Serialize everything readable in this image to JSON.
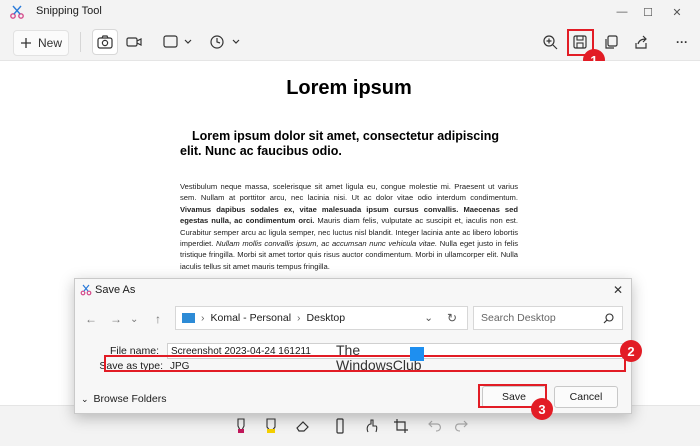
{
  "window": {
    "title": "Snipping Tool",
    "minimize": "—",
    "maximize": "☐",
    "close": "✕"
  },
  "toolbar": {
    "new_label": "New",
    "more": "···"
  },
  "document": {
    "title": "Lorem ipsum",
    "subtitle": "Lorem ipsum dolor sit amet, consectetur adipiscing elit. Nunc ac faucibus odio.",
    "body_parts": [
      "Vestibulum neque massa, scelerisque sit amet ligula eu, congue molestie mi. Praesent ut varius sem. Nullam at porttitor arcu, nec lacinia nisi. Ut ac dolor vitae odio interdum condimentum. ",
      "Vivamus dapibus sodales ex, vitae malesuada ipsum cursus convallis. Maecenas sed egestas nulla, ac condimentum orci.",
      " Mauris diam felis, vulputate ac suscipit et, iaculis non est. Curabitur semper arcu ac ligula semper, nec luctus nisl blandit. Integer lacinia ante ac libero lobortis imperdiet. ",
      "Nullam mollis convallis ipsum, ac accumsan nunc vehicula vitae.",
      " Nulla eget justo in felis tristique fringilla. Morbi sit amet tortor quis risus auctor condimentum. Morbi in ullamcorper elit. Nulla iaculis tellus sit amet mauris tempus fringilla."
    ]
  },
  "dialog": {
    "title": "Save As",
    "close": "✕",
    "path": [
      "Komal - Personal",
      "Desktop"
    ],
    "search_placeholder": "Search Desktop",
    "file_name_label": "File name:",
    "file_name_value": "Screenshot 2023-04-24 161211",
    "save_type_label": "Save as type:",
    "save_type_value": "JPG",
    "browse_folders": "Browse Folders",
    "save_button": "Save",
    "cancel_button": "Cancel"
  },
  "annotations": {
    "marker1": "1",
    "marker2": "2",
    "marker3": "3",
    "color": "#e21c25"
  },
  "watermark": {
    "line1": "The",
    "line2": "WindowsClub"
  }
}
